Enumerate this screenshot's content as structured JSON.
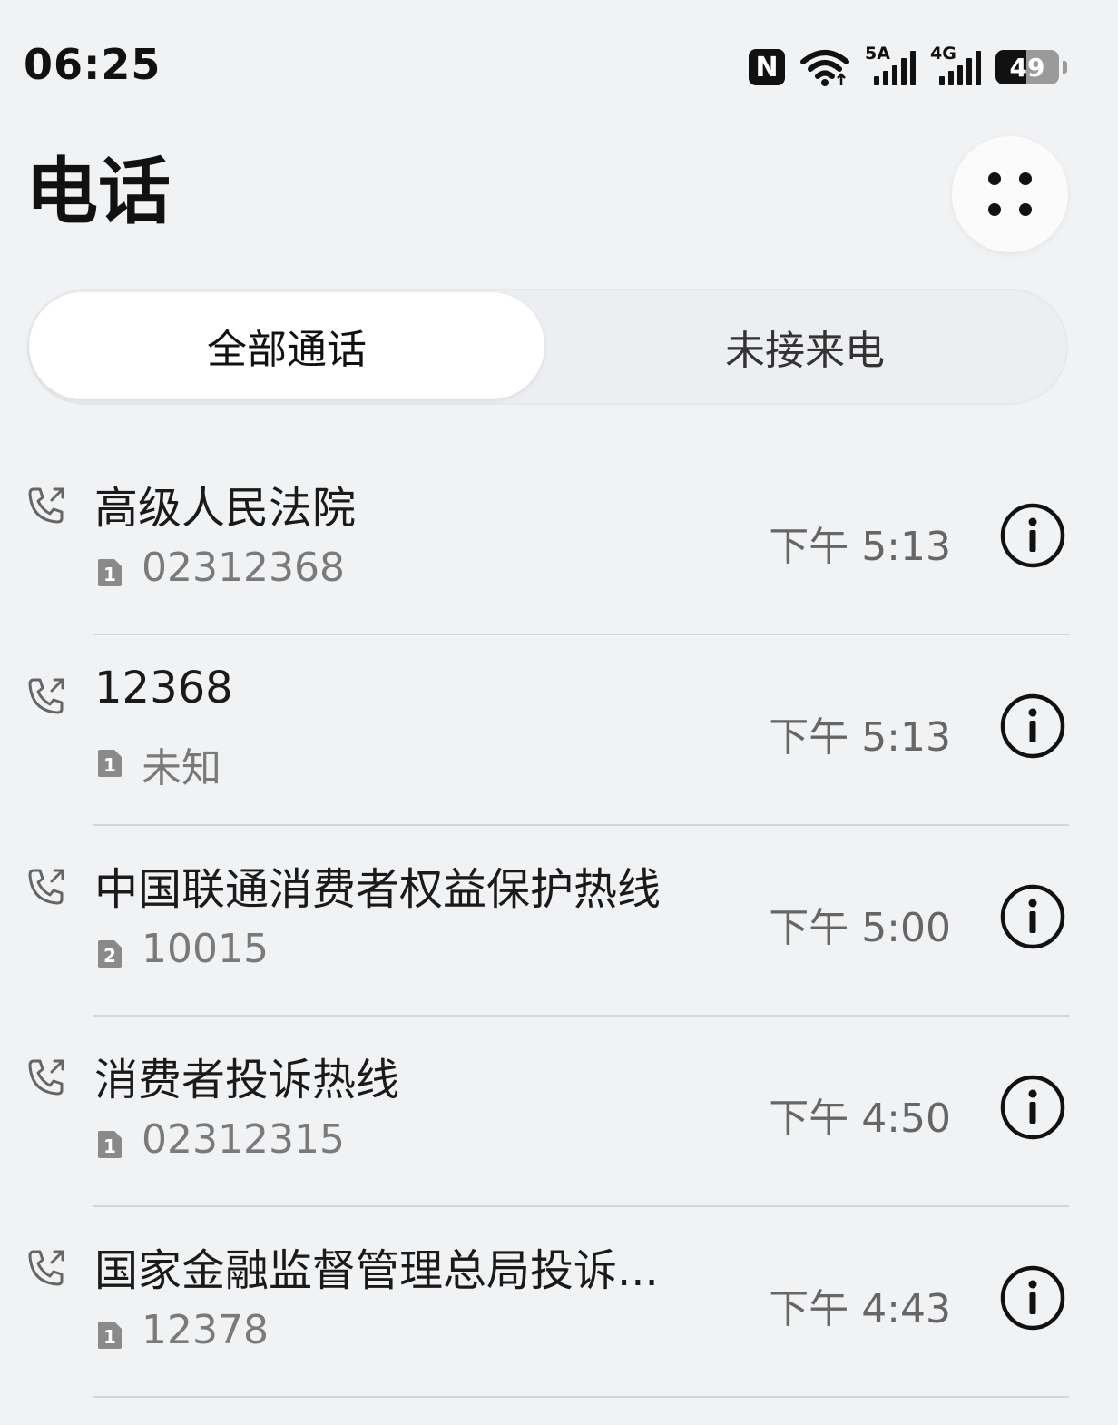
{
  "status_bar": {
    "time": "06:25",
    "nfc_label": "N",
    "signal1_label": "5A",
    "signal2_label": "4G",
    "battery": "49",
    "battery_level": 0.49
  },
  "header": {
    "title": "电话"
  },
  "tabs": [
    {
      "label": "全部通话",
      "active": true
    },
    {
      "label": "未接来电",
      "active": false
    }
  ],
  "calls": [
    {
      "name": "高级人民法院",
      "sim": "1",
      "number": "02312368",
      "time": "下午 5:13"
    },
    {
      "name": "12368",
      "sim": "1",
      "number": "未知",
      "time": "下午 5:13"
    },
    {
      "name": "中国联通消费者权益保护热线",
      "sim": "2",
      "number": "10015",
      "time": "下午 5:00"
    },
    {
      "name": "消费者投诉热线",
      "sim": "1",
      "number": "02312315",
      "time": "下午 4:50"
    },
    {
      "name": "国家金融监督管理总局投诉...",
      "sim": "1",
      "number": "12378",
      "time": "下午 4:43"
    }
  ],
  "icons": {
    "call_type": "outgoing-call-icon",
    "info": "info-icon",
    "more": "more-dots-icon"
  },
  "colors": {
    "background": "#f1f2f4",
    "text_primary": "#1a1a1a",
    "text_secondary": "#7a7a7a"
  }
}
